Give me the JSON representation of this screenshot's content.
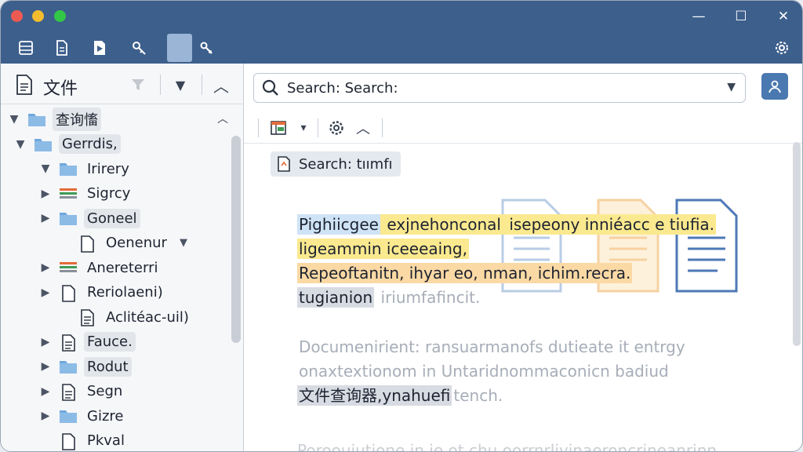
{
  "titlebar": {
    "window_controls": {
      "minimize": "—",
      "maximize": "☐",
      "close": "✕"
    },
    "tools": [
      "list-icon",
      "document-icon",
      "play-icon",
      "key-icon",
      "blank-tab",
      "wrench-icon"
    ],
    "settings_icon": "gear-icon"
  },
  "sidebar": {
    "title": "文件",
    "tree": [
      {
        "label": "查询慉",
        "arrow": "▼",
        "icon": "folder",
        "level": 0,
        "highlight": true
      },
      {
        "label": "Gerrdis,",
        "arrow": "▼",
        "icon": "folder",
        "level": 1,
        "highlight": true
      },
      {
        "label": "Irirery",
        "arrow": "▼",
        "icon": "folder",
        "level": 2,
        "highlight": false
      },
      {
        "label": "Sigrcy",
        "arrow": "▶",
        "icon": "stack",
        "level": 2,
        "highlight": false
      },
      {
        "label": "Goneel",
        "arrow": "▶",
        "icon": "folder",
        "level": 2,
        "highlight": true
      },
      {
        "label": "Oenenur",
        "arrow": "",
        "icon": "file",
        "level": 3,
        "highlight": false,
        "dropdown": "▼"
      },
      {
        "label": "Anereterri",
        "arrow": "▶",
        "icon": "stack",
        "level": 2,
        "highlight": false
      },
      {
        "label": "Reriolaeni)",
        "arrow": "▶",
        "icon": "file",
        "level": 2,
        "highlight": false
      },
      {
        "label": "Aclitéac-uil)",
        "arrow": "",
        "icon": "file-lines",
        "level": 3,
        "highlight": false
      },
      {
        "label": "Fauce.",
        "arrow": "▶",
        "icon": "file-lines",
        "level": 2,
        "highlight": true
      },
      {
        "label": "Rodut",
        "arrow": "▶",
        "icon": "folder",
        "level": 2,
        "highlight": true
      },
      {
        "label": "Segn",
        "arrow": "▶",
        "icon": "file-lines",
        "level": 2,
        "highlight": false
      },
      {
        "label": "Gizre",
        "arrow": "▶",
        "icon": "folder",
        "level": 2,
        "highlight": false
      },
      {
        "label": "Pkval",
        "arrow": "",
        "icon": "file",
        "level": 2,
        "highlight": false
      }
    ]
  },
  "main": {
    "search": {
      "text": "Search:   Search:"
    },
    "chip": {
      "label": "Search: tıımfı"
    },
    "paragraphs": [
      [
        {
          "t": "Pighiicgee",
          "c": "hb"
        },
        {
          "t": " exjnehonconal ",
          "c": "hy"
        },
        {
          "t": "isepeony inniéacc e tiufia.",
          "c": "hy"
        }
      ],
      [
        {
          "t": "ligeammin iceeeaing,",
          "c": "hy"
        }
      ],
      [
        {
          "t": "Repeoftanitn, ihyar eo, nman, ichim.recra.",
          "c": "ho"
        }
      ],
      [
        {
          "t": "tugianion",
          "c": "hg"
        },
        {
          "t": " iriumfafincit.",
          "c": "faded"
        }
      ]
    ],
    "paragraphs2": [
      [
        {
          "t": "Documenirient: ransuarmanofs dutieate it entrgy",
          "c": "faded"
        }
      ],
      [
        {
          "t": "onaxtextionom in Untaridnommaconicn badiud",
          "c": "faded"
        }
      ],
      [
        {
          "t": "文件查询器,ynahuefi",
          "c": "hg"
        },
        {
          "t": "tench.",
          "c": "faded"
        }
      ]
    ],
    "bottom_faded": "Poroouiutione in ie ot chu oorrnrlivinaeroncrineanrinn"
  }
}
